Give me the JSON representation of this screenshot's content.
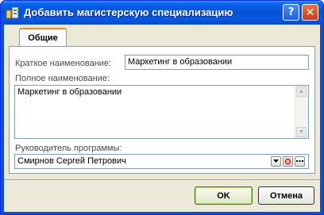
{
  "window": {
    "title": "Добавить магистерскую специализацию",
    "help_glyph": "?",
    "close_glyph": "✕"
  },
  "tabs": [
    {
      "label": "Общие",
      "active": true
    }
  ],
  "form": {
    "short_name": {
      "label": "Краткое наименование:",
      "value": "Маркетинг в образовании"
    },
    "full_name": {
      "label": "Полное наименование:",
      "value": "Маркетинг в образовании"
    },
    "program_head": {
      "label": "Руководитель программы:",
      "value": "Смирнов Сергей Петрович"
    }
  },
  "buttons": {
    "ok": "OK",
    "cancel": "Отмена"
  },
  "icons": {
    "combo": [
      "dropdown-arrow-icon",
      "clear-icon",
      "ellipsis-icon"
    ]
  },
  "colors": {
    "titlebar": "#0552d8",
    "tab_accent": "#e68b2c",
    "clear_icon": "#e03a2a"
  }
}
